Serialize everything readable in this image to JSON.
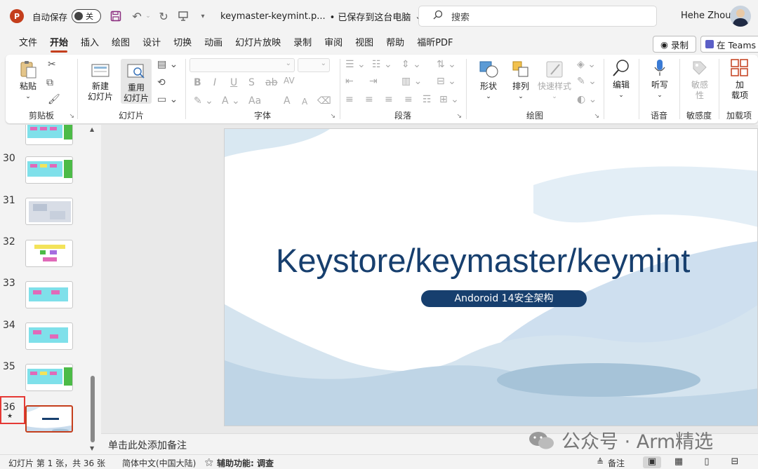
{
  "titlebar": {
    "app_logo": "P",
    "autosave_label": "自动保存",
    "autosave_state": "关",
    "doc_title": "keymaster-keymint.p...",
    "saved_status": "• 已保存到这台电脑",
    "search_placeholder": "搜索",
    "user_name": "Hehe Zhou"
  },
  "menu": {
    "tabs": [
      "文件",
      "开始",
      "插入",
      "绘图",
      "设计",
      "切换",
      "动画",
      "幻灯片放映",
      "录制",
      "审阅",
      "视图",
      "帮助",
      "福昕PDF"
    ],
    "active": "开始",
    "record_label": "录制",
    "teams_label": "在 Teams"
  },
  "ribbon": {
    "clipboard": {
      "paste": "粘贴",
      "label": "剪贴板"
    },
    "slides": {
      "new_slide": "新建\n幻灯片",
      "reuse_slide": "重用\n幻灯片",
      "label": "幻灯片"
    },
    "font": {
      "label": "字体",
      "bold": "B",
      "italic": "I",
      "underline": "U",
      "strike": "S",
      "strike2": "ab",
      "spacing": "AV",
      "case": "Aa",
      "grow": "A",
      "shrink": "A"
    },
    "paragraph": {
      "label": "段落"
    },
    "drawing": {
      "shapes": "形状",
      "arrange": "排列",
      "quick_styles": "快速样式",
      "label": "绘图"
    },
    "editing": {
      "edit": "编辑"
    },
    "voice": {
      "dictate": "听写",
      "label": "语音"
    },
    "sensitivity": {
      "button": "敏感\n性",
      "label": "敏感度"
    },
    "addins": {
      "button": "加\n载项",
      "label": "加载项"
    }
  },
  "thumbnails": {
    "numbers": [
      "30",
      "31",
      "32",
      "33",
      "34",
      "35",
      "36"
    ],
    "selected": "36",
    "selected_star": "★"
  },
  "slide": {
    "title": "Keystore/keymaster/keymint",
    "subtitle": "Andoroid 14安全架构"
  },
  "notes": {
    "placeholder": "单击此处添加备注"
  },
  "watermark": {
    "text": "公众号 · Arm精选"
  },
  "statusbar": {
    "slide_count": "幻灯片 第 1 张，共 36 张",
    "language": "简体中文(中国大陆)",
    "accessibility": "辅助功能: 调查",
    "notes_button": "备注"
  },
  "colors": {
    "accent": "#c43e1c",
    "slide_title": "#173f6e",
    "selection_box": "#e53935"
  }
}
